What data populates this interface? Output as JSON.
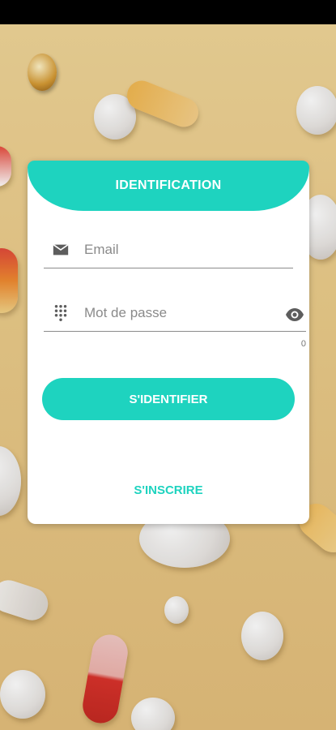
{
  "login": {
    "title": "IDENTIFICATION",
    "email": {
      "placeholder": "Email",
      "icon": "email-icon"
    },
    "password": {
      "placeholder": "Mot de passe",
      "icon": "dialpad-icon",
      "toggle_icon": "eye-icon"
    },
    "password_counter": "0",
    "submit_label": "S'IDENTIFIER",
    "register_label": "S'INSCRIRE"
  },
  "colors": {
    "accent": "#1ed3bf",
    "background": "#e8c983",
    "card": "#ffffff"
  }
}
